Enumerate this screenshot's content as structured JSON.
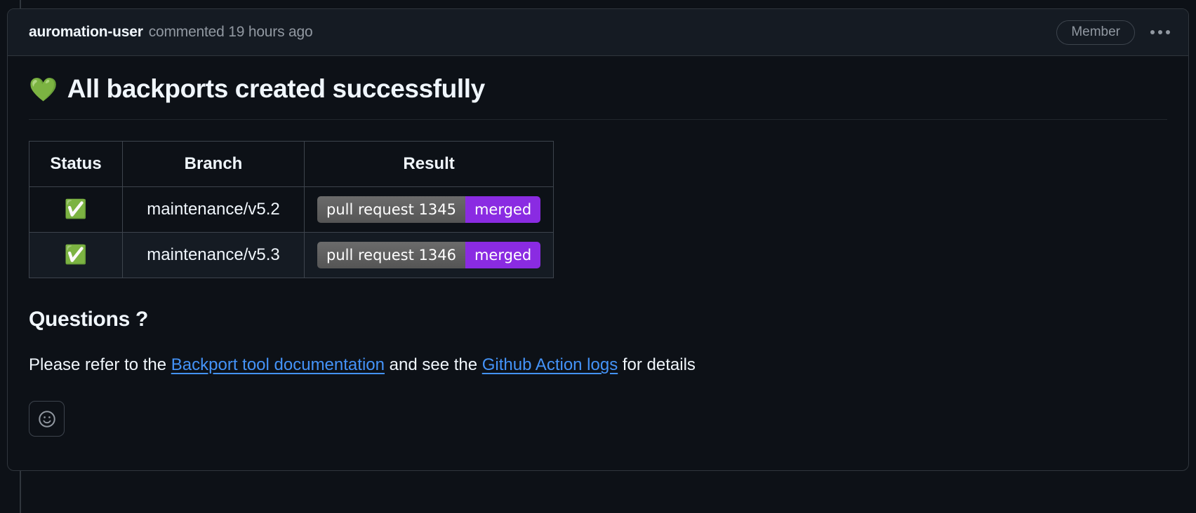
{
  "header": {
    "author": "auromation-user",
    "meta": "commented 19 hours ago",
    "badge_label": "Member",
    "kebab_icon": "kebab-horizontal-icon"
  },
  "body": {
    "title_emoji": "💚",
    "title": "All backports created successfully",
    "table": {
      "columns": [
        "Status",
        "Branch",
        "Result"
      ],
      "rows": [
        {
          "status_emoji": "✅",
          "branch": "maintenance/v5.2",
          "badge_left": "pull request 1345",
          "badge_right": "merged"
        },
        {
          "status_emoji": "✅",
          "branch": "maintenance/v5.3",
          "badge_left": "pull request 1346",
          "badge_right": "merged"
        }
      ]
    },
    "questions_heading": "Questions ?",
    "paragraph": {
      "prefix": "Please refer to the ",
      "link1": "Backport tool documentation",
      "middle": " and see the ",
      "link2": "Github Action logs",
      "suffix": " for details"
    },
    "reaction_icon": "smiley-icon"
  },
  "colors": {
    "badge_right_bg": "#8a2be2",
    "badge_left_bg": "#555555",
    "link": "#4493f8",
    "page_bg": "#0d1117",
    "header_bg": "#151b23",
    "border": "#30363d"
  }
}
